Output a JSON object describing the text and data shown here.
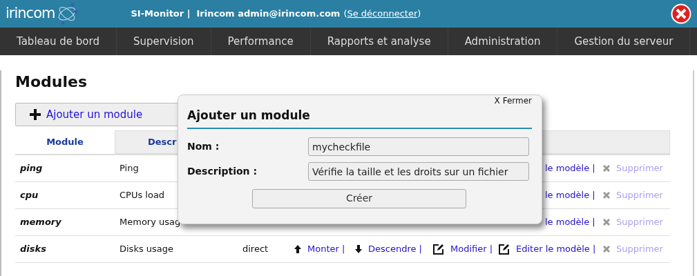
{
  "header": {
    "logo": "irincom",
    "app": "SI-Monitor |",
    "user": "Irincom admin@irincom.com",
    "logout_before": "(",
    "logout": "Se déconnecter",
    "logout_after": ")"
  },
  "nav": [
    {
      "label": "Tableau de bord"
    },
    {
      "label": "Supervision"
    },
    {
      "label": "Performance"
    },
    {
      "label": "Rapports et analyse"
    },
    {
      "label": "Administration"
    },
    {
      "label": "Gestion du serveur"
    }
  ],
  "page_title": "Modules",
  "add_button": "Ajouter un module",
  "table": {
    "columns": [
      {
        "label": "Module",
        "selected": true
      },
      {
        "label": "Descr",
        "selected": false
      }
    ],
    "rows": [
      {
        "name": "ping",
        "description": "Ping",
        "template": "le modèle |",
        "delete": "Supprimer"
      },
      {
        "name": "cpu",
        "description": "CPUs load",
        "template": "le modèle |",
        "delete": "Supprimer"
      },
      {
        "name": "memory",
        "description": "Memory usag",
        "template": "le modèle |",
        "delete": "Supprimer"
      },
      {
        "name": "disks",
        "description": "Disks usage",
        "mode": "direct",
        "up": "Monter |",
        "down": "Descendre |",
        "modify": "Modifier |",
        "template": "Editer le modèle |",
        "delete": "Supprimer"
      }
    ]
  },
  "dialog": {
    "close": "X Fermer",
    "title": "Ajouter un module",
    "fields": [
      {
        "label": "Nom :",
        "value": "mycheckfile"
      },
      {
        "label": "Description :",
        "value": "Vérifie la taille et les droits sur un fichier"
      }
    ],
    "submit": "Créer"
  }
}
